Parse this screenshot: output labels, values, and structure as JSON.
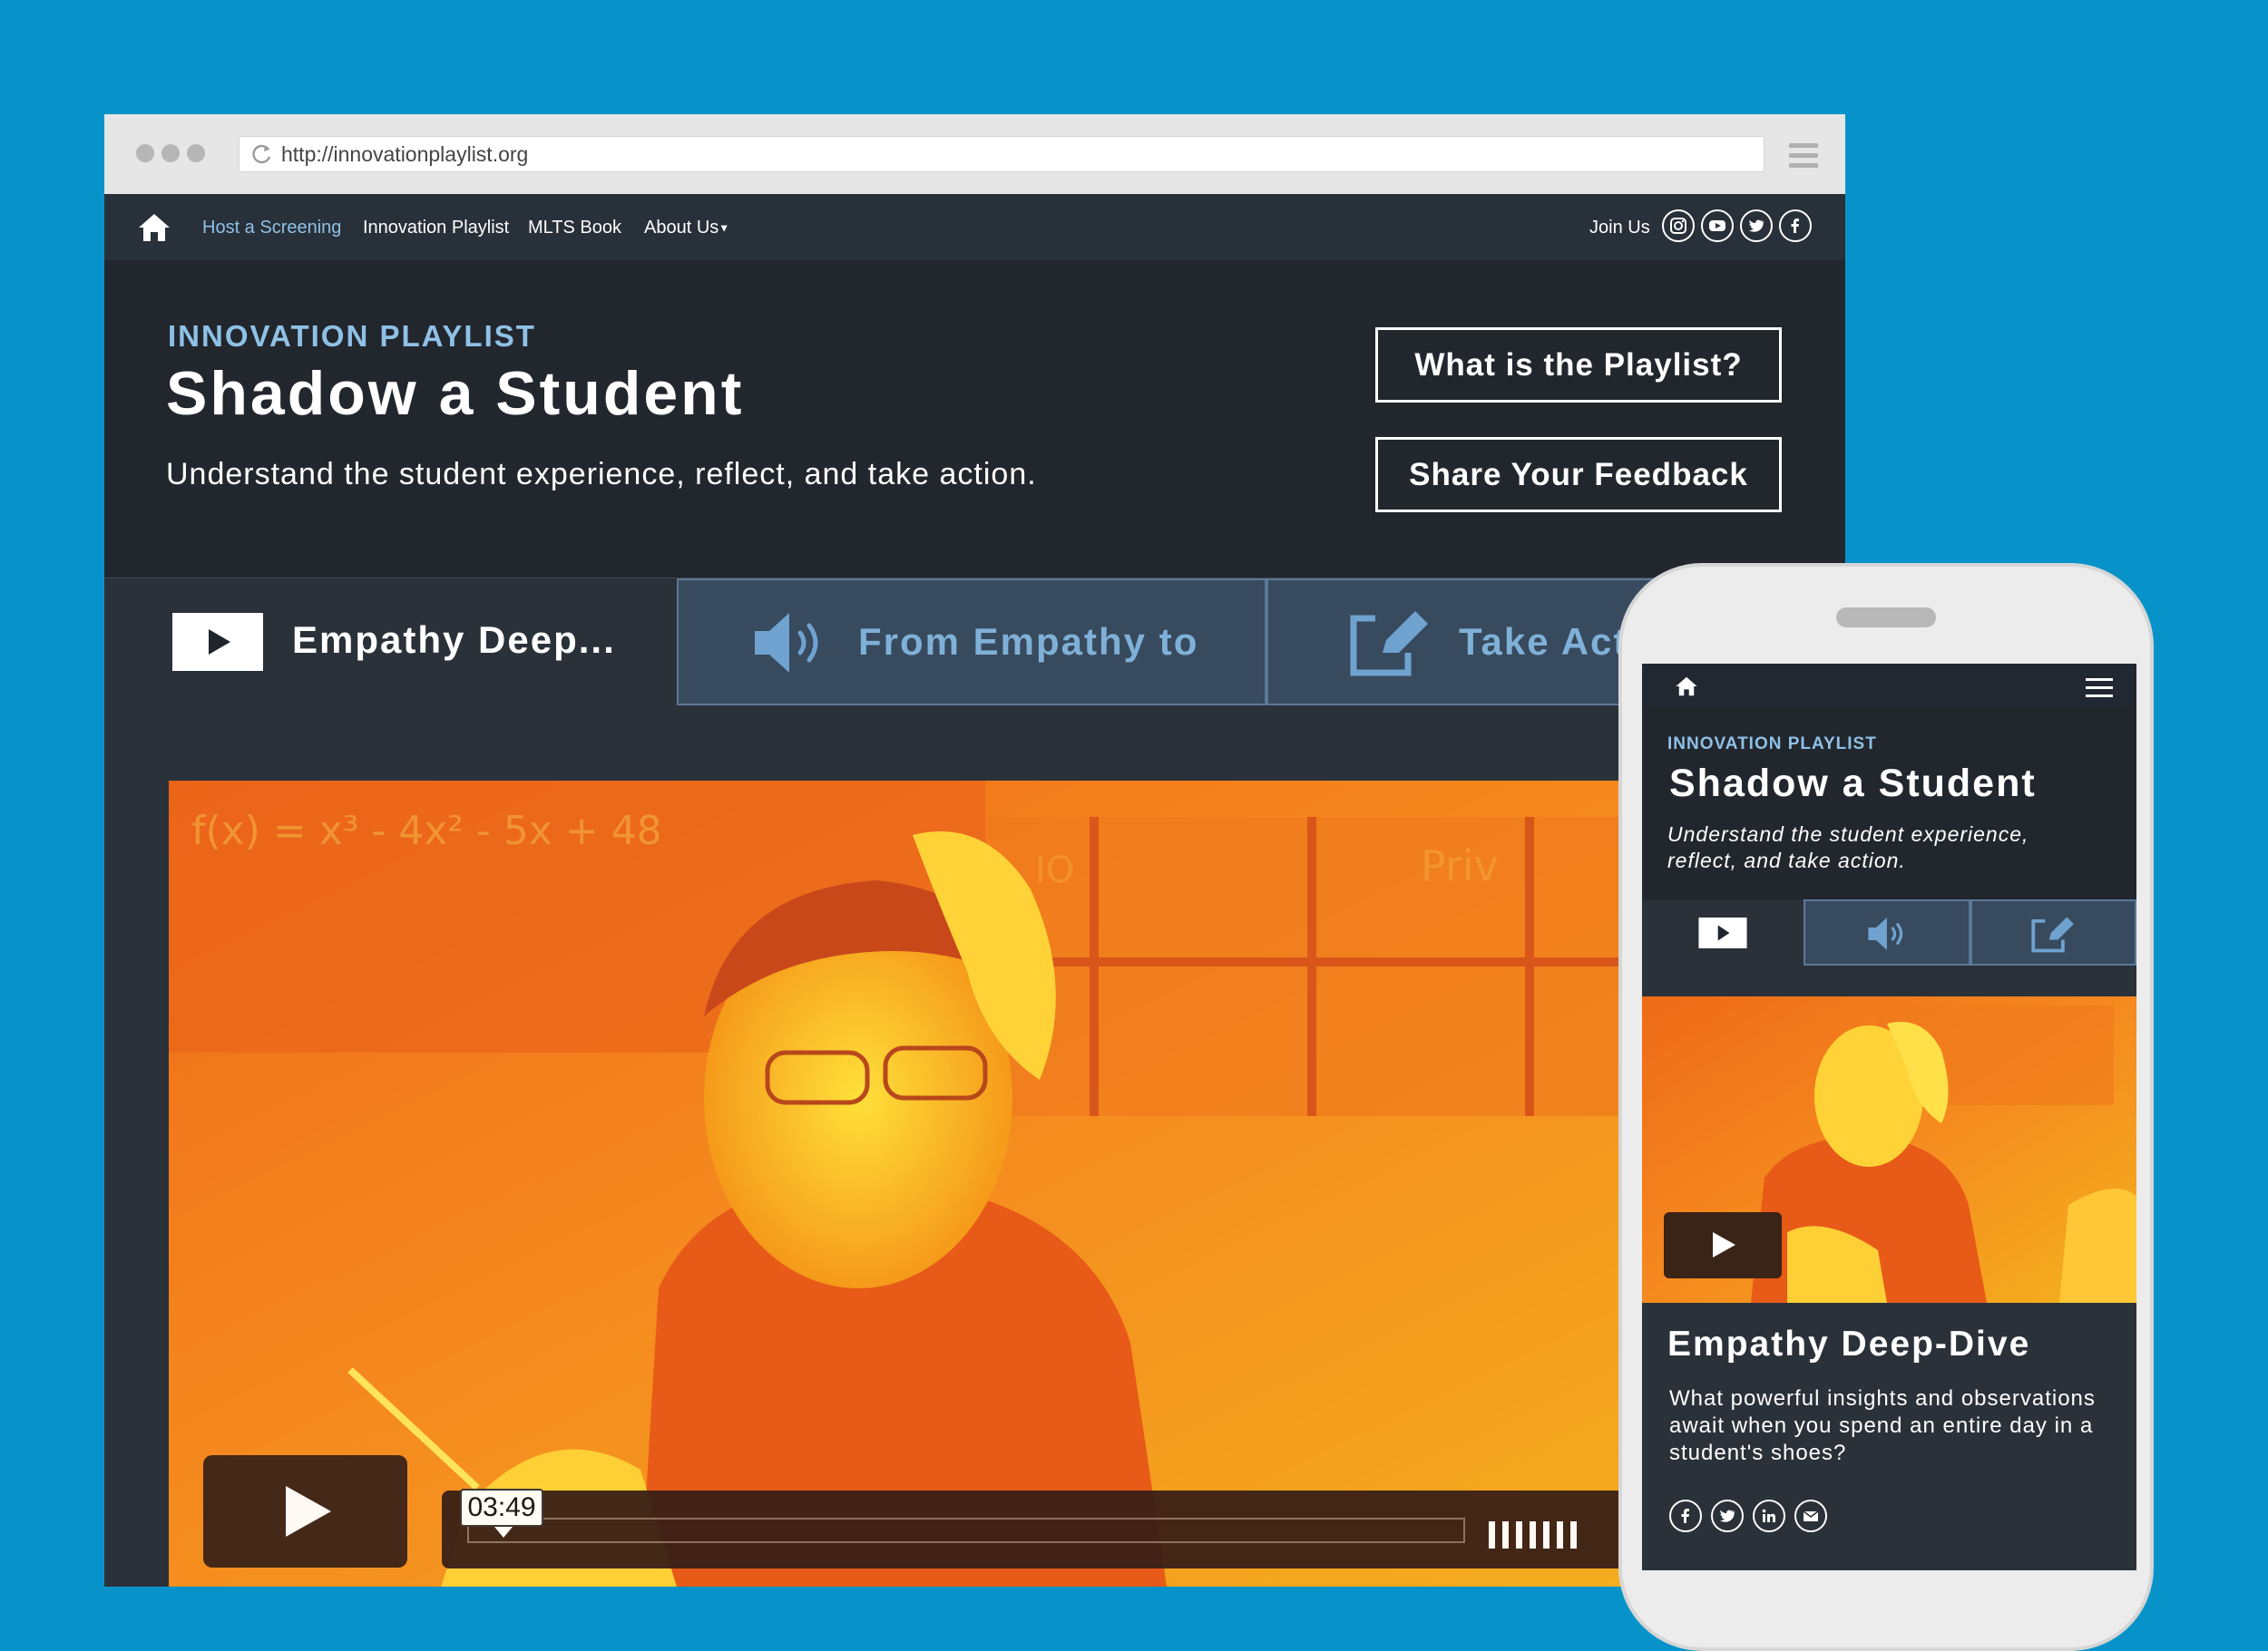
{
  "browser": {
    "url": "http://innovationplaylist.org"
  },
  "site": {
    "nav": {
      "items": [
        {
          "label": "Host a Screening",
          "active": true
        },
        {
          "label": "Innovation Playlist",
          "active": false
        },
        {
          "label": "MLTS Book",
          "active": false
        },
        {
          "label": "About Us",
          "active": false
        }
      ],
      "join_label": "Join Us",
      "social_icons": [
        "instagram-icon",
        "youtube-icon",
        "twitter-icon",
        "facebook-icon"
      ]
    },
    "hero": {
      "eyebrow": "INNOVATION PLAYLIST",
      "title": "Shadow a Student",
      "subtitle": "Understand the student experience, reflect, and take action.",
      "buttons": [
        "What is the Playlist?",
        "Share Your Feedback"
      ]
    },
    "tabs": [
      {
        "label": "Empathy Deep...",
        "icon": "video-play-icon",
        "active": true
      },
      {
        "label": "From Empathy to",
        "icon": "speaker-icon",
        "active": false
      },
      {
        "label": "Take Act",
        "icon": "edit-icon",
        "active": false
      }
    ],
    "video": {
      "time": "03:49",
      "board_text": "f(x) = x³ - 4x² - 5x + 48",
      "sign_text": "Priv",
      "sign_text_2": "IO"
    }
  },
  "mobile": {
    "hero": {
      "eyebrow": "INNOVATION PLAYLIST",
      "title": "Shadow a Student",
      "subtitle": "Understand the student experience, reflect, and take action."
    },
    "card": {
      "title": "Empathy Deep-Dive",
      "text": "What powerful insights and observations await when you spend an entire day in a student's shoes?",
      "share_icons": [
        "facebook-icon",
        "twitter-icon",
        "linkedin-icon",
        "email-icon"
      ]
    }
  },
  "colors": {
    "background": "#0793c9",
    "nav_bg": "#283039",
    "hero_bg": "#22272e",
    "accent_blue": "#8fc1e6",
    "tab_inactive": "#384a5d",
    "tab_text_inactive": "#7fb0d8"
  }
}
